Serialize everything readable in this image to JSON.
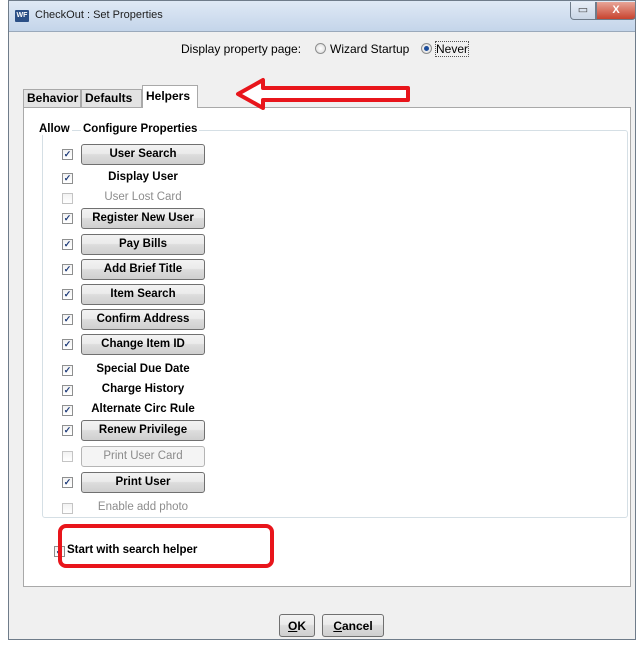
{
  "window": {
    "title": "CheckOut : Set Properties",
    "icon_label": "WF",
    "minimize_glyph": "▭",
    "close_glyph": "X"
  },
  "display_property": {
    "label": "Display property page:",
    "options": [
      {
        "label": "Wizard Startup",
        "selected": false
      },
      {
        "label": "Never",
        "selected": true
      }
    ]
  },
  "tabs": [
    {
      "label": "Behavior",
      "active": false
    },
    {
      "label": "Defaults",
      "active": false
    },
    {
      "label": "Helpers",
      "active": true
    }
  ],
  "helpers": {
    "col_allow": "Allow",
    "col_configure": "Configure Properties",
    "rows": [
      {
        "label": "User Search",
        "checked": true,
        "kind": "button",
        "enabled": true
      },
      {
        "label": "Display User",
        "checked": true,
        "kind": "text",
        "enabled": true
      },
      {
        "label": "User Lost Card",
        "checked": false,
        "kind": "text",
        "enabled": false
      },
      {
        "label": "Register New User",
        "checked": true,
        "kind": "button",
        "enabled": true
      },
      {
        "label": "Pay Bills",
        "checked": true,
        "kind": "button",
        "enabled": true
      },
      {
        "label": "Add Brief Title",
        "checked": true,
        "kind": "button",
        "enabled": true
      },
      {
        "label": "Item Search",
        "checked": true,
        "kind": "button",
        "enabled": true
      },
      {
        "label": "Confirm Address",
        "checked": true,
        "kind": "button",
        "enabled": true
      },
      {
        "label": "Change Item ID",
        "checked": true,
        "kind": "button",
        "enabled": true
      },
      {
        "label": "Special Due Date",
        "checked": true,
        "kind": "text",
        "enabled": true
      },
      {
        "label": "Charge History",
        "checked": true,
        "kind": "text",
        "enabled": true
      },
      {
        "label": "Alternate Circ Rule",
        "checked": true,
        "kind": "text",
        "enabled": true
      },
      {
        "label": "Renew Privilege",
        "checked": true,
        "kind": "button",
        "enabled": true
      },
      {
        "label": "Print User Card",
        "checked": false,
        "kind": "button",
        "enabled": false
      },
      {
        "label": "Print User",
        "checked": true,
        "kind": "button",
        "enabled": true
      },
      {
        "label": "Enable add photo",
        "checked": false,
        "kind": "text",
        "enabled": false
      }
    ],
    "start_with_search": {
      "label": "Start with search helper",
      "checked": true
    }
  },
  "buttons": {
    "ok": {
      "mnemonic": "O",
      "rest": "K"
    },
    "cancel": {
      "mnemonic": "C",
      "rest": "ancel"
    }
  },
  "annotation_color": "#e8151b",
  "accent": "#1c4c9a"
}
